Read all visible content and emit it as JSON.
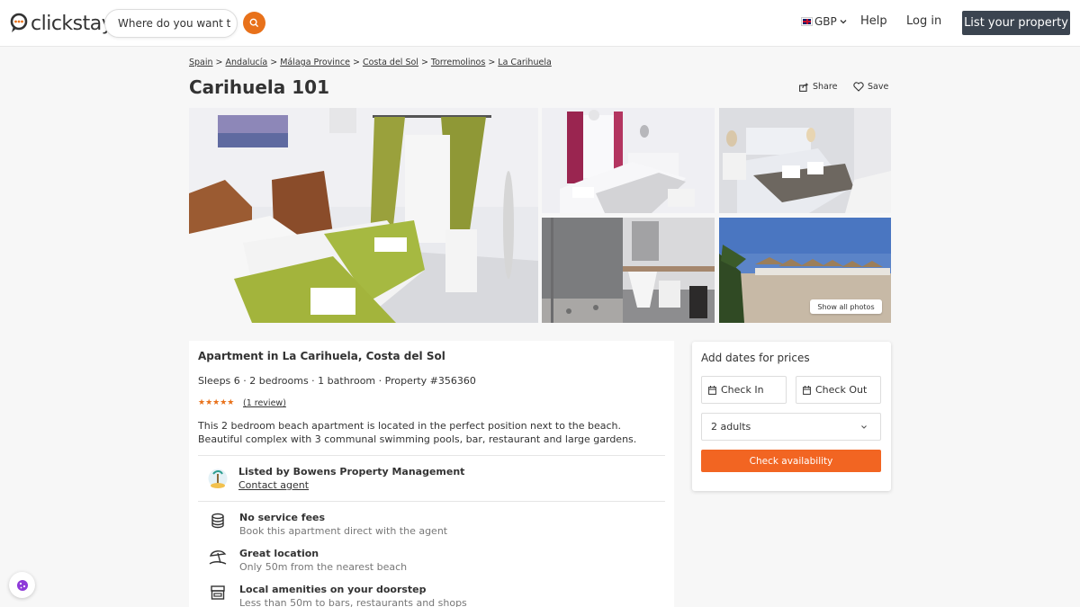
{
  "header": {
    "logo_text": "clickstay",
    "search_placeholder": "Where do you want to go?",
    "currency": "GBP",
    "help": "Help",
    "login": "Log in",
    "list_property": "List your property"
  },
  "breadcrumb": [
    "Spain",
    "Andalucía",
    "Málaga Province",
    "Costa del Sol",
    "Torremolinos",
    "La Carihuela"
  ],
  "page": {
    "title": "Carihuela 101",
    "share": "Share",
    "save": "Save",
    "show_all_photos": "Show all photos"
  },
  "listing": {
    "heading": "Apartment in La Carihuela, Costa del Sol",
    "meta": "Sleeps 6 · 2 bedrooms · 1 bathroom · Property #356360",
    "stars": "★★★★★",
    "rating": 5,
    "review_link": "(1 review)",
    "description": "This 2 bedroom beach apartment is located in the perfect position next to the beach. Beautiful complex with 3 communal swimming pools, bar, restaurant and large gardens.",
    "agent": "Listed by Bowens Property Management",
    "contact": "Contact agent",
    "features": [
      {
        "icon": "coins-icon",
        "title": "No service fees",
        "subtitle": "Book this apartment direct with the agent"
      },
      {
        "icon": "beach-umbrella-icon",
        "title": "Great location",
        "subtitle": "Only 50m from the nearest beach"
      },
      {
        "icon": "shop-icon",
        "title": "Local amenities on your doorstep",
        "subtitle": "Less than 50m to bars, restaurants and shops"
      }
    ]
  },
  "booking": {
    "title": "Add dates for prices",
    "check_in": "Check In",
    "check_out": "Check Out",
    "guests": "2 adults",
    "button": "Check availability"
  },
  "colors": {
    "accent": "#f26522",
    "search_button": "#e8711a",
    "list_button": "#3b4450"
  }
}
